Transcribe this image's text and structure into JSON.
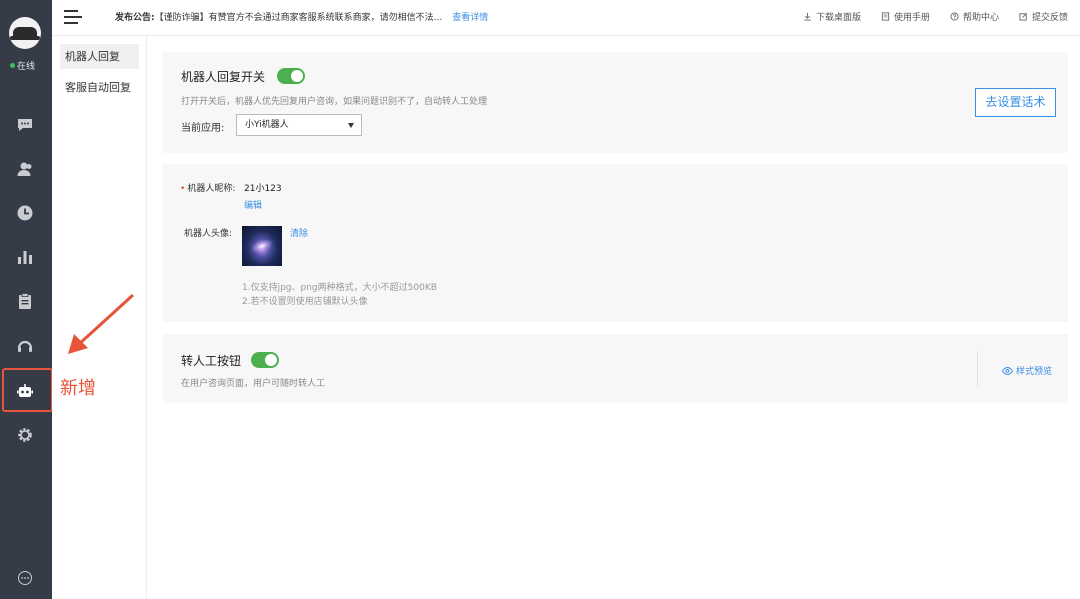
{
  "rail": {
    "status": "在线",
    "nav_icons": [
      "chat-icon",
      "contacts-icon",
      "history-icon",
      "stats-icon",
      "clipboard-icon",
      "headset-icon",
      "robot-icon",
      "settings-icon"
    ],
    "bottom_icon": "more-icon"
  },
  "annotation": {
    "text": "新增",
    "color": "#e8543a"
  },
  "topbar": {
    "notice_label": "发布公告:",
    "notice_text": "【谨防诈骗】有赞官方不会通过商家客服系统联系商家，请勿相信不法...",
    "notice_link": "查看详情",
    "links": [
      {
        "icon": "download-icon",
        "label": "下载桌面版"
      },
      {
        "icon": "manual-icon",
        "label": "使用手册"
      },
      {
        "icon": "help-icon",
        "label": "帮助中心"
      },
      {
        "icon": "feedback-icon",
        "label": "提交反馈"
      }
    ]
  },
  "subnav": {
    "items": [
      {
        "label": "机器人回复",
        "active": true
      },
      {
        "label": "客服自动回复",
        "active": false
      }
    ]
  },
  "robot_switch": {
    "title": "机器人回复开关",
    "enabled": true,
    "description": "打开开关后，机器人优先回复用户咨询，如果问题识别不了，自动转人工处理",
    "app_label": "当前应用:",
    "app_value": "小Yi机器人",
    "setup_button": "去设置话术"
  },
  "robot_profile": {
    "nickname_label": "机器人昵称:",
    "nickname_value": "21小123",
    "edit_link": "编辑",
    "avatar_label": "机器人头像:",
    "clear_link": "清除",
    "hint_1": "1.仅支持jpg、png两种格式，大小不超过500KB",
    "hint_2": "2.若不设置则使用店铺默认头像"
  },
  "transfer": {
    "title": "转人工按钮",
    "enabled": true,
    "description": "在用户咨询页面，用户可随时转人工",
    "preview_link": "样式预览"
  },
  "colors": {
    "rail_bg": "#353c47",
    "accent": "#3a8ee6",
    "toggle_on": "#4caf50",
    "annotation": "#e8543a"
  }
}
